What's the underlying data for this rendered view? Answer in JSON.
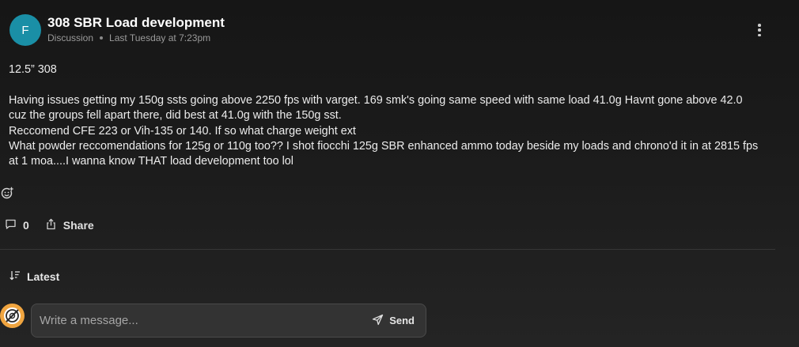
{
  "post": {
    "avatar_initial": "F",
    "avatar_color": "#1a8fa6",
    "title": "308 SBR Load development",
    "category": "Discussion",
    "timestamp": "Last Tuesday at 7:23pm",
    "menu_icon": "kebab-menu-icon"
  },
  "body": {
    "line1": "12.5” 308",
    "line2": "Having issues getting my 150g ssts going above 2250 fps with varget. 169 smk's going same speed with same load 41.0g Havnt gone above 42.0",
    "line3": "cuz the groups fell apart there, did best at 41.0g with the 150g sst.",
    "line4": "Reccomend CFE 223 or Vih-135 or 140. If so what charge weight ext",
    "line5": "What powder reccomendations for 125g or 110g too?? I shot fiocchi 125g SBR enhanced ammo today beside my loads and chrono'd it in at 2815 fps",
    "line6": "at 1 moa....I wanna know THAT load development too lol"
  },
  "actions": {
    "reaction_icon": "add-reaction-icon",
    "comment_count": "0",
    "share_label": "Share"
  },
  "sort": {
    "label": "Latest",
    "icon": "sort-descending-icon"
  },
  "composer": {
    "placeholder": "Write a message...",
    "send_label": "Send",
    "avatar_color": "#f0a540"
  }
}
